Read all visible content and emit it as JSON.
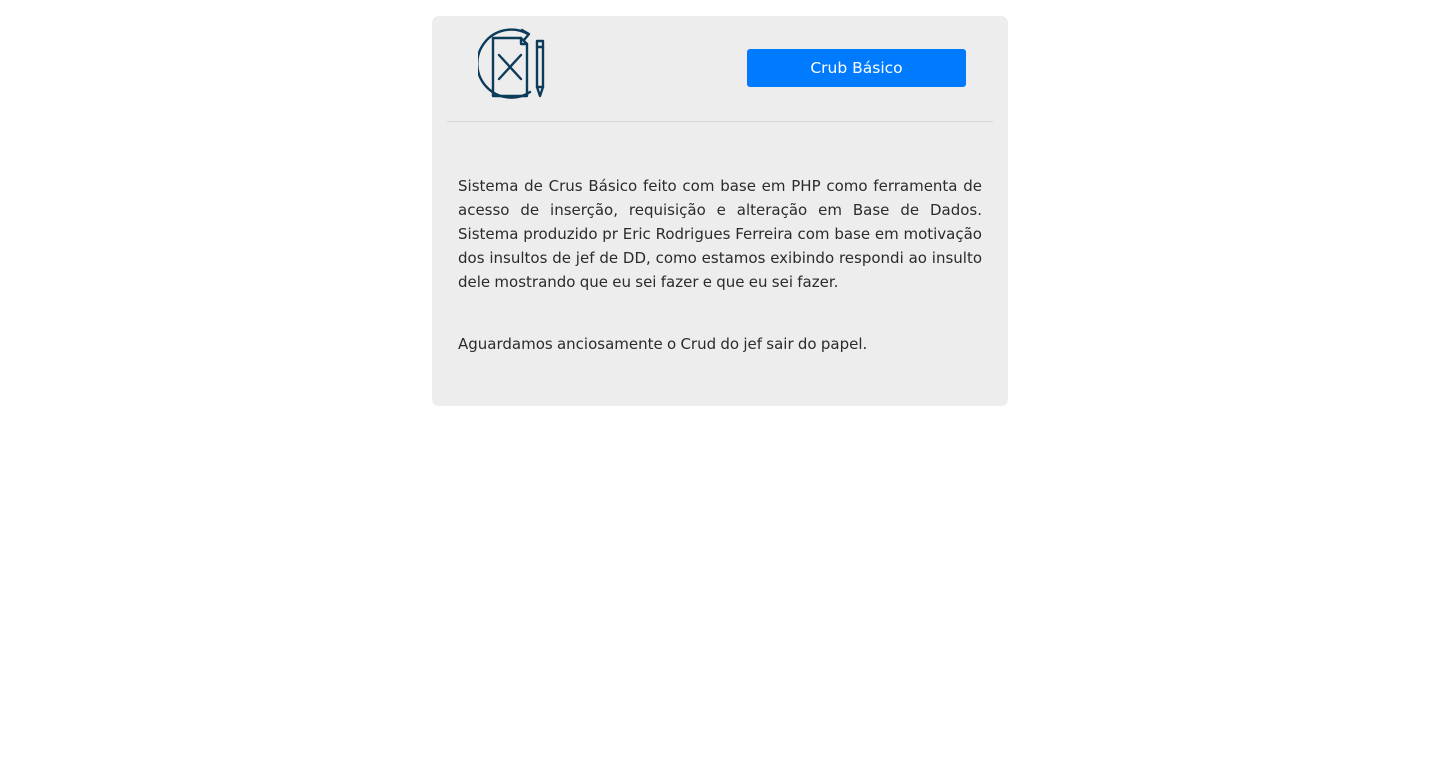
{
  "header": {
    "logo_icon": "document-edit-icon",
    "logo_color": "#0d3b5a",
    "button_label": "Crub Básico",
    "button_color": "#007bff"
  },
  "body": {
    "paragraph_1": "Sistema de Crus Básico feito com base em PHP como ferramenta de acesso de inserção, requisição e alteração em Base de Dados. Sistema produzido pr Eric Rodrigues Ferreira com base em motivação dos insultos de jef de DD, como estamos exibindo respondi ao insulto dele mostrando que eu sei fazer e que eu sei fazer.",
    "paragraph_2": "Aguardamos anciosamente o Crud do jef sair do papel."
  }
}
